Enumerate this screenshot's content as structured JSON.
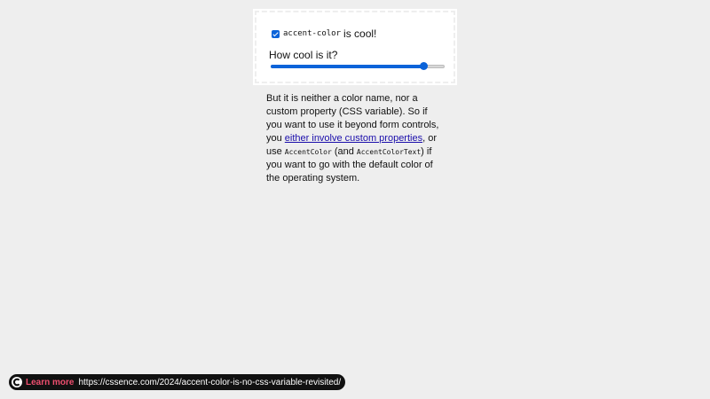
{
  "card": {
    "checkbox_checked": true,
    "checkbox_code": "accent-color",
    "checkbox_label": "is cool!",
    "slider_label": "How cool is it?",
    "slider_value_fraction": 0.88
  },
  "prose": {
    "text_1": "But it is neither a color name, nor a custom property (CSS variable). So if you want to use it beyond form controls, you ",
    "link_text": "either involve custom properties",
    "text_2": ", or use ",
    "code_1": "AccentColor",
    "text_3": " (and ",
    "code_2": "AccentColorText",
    "text_4": ") if you want to go with the default color of the operating system."
  },
  "badge": {
    "icon": "cssence-logo-icon",
    "label": "Learn more",
    "url": "https://cssence.com/2024/accent-color-is-no-css-variable-revisited/"
  },
  "colors": {
    "accent": "#0b63d9",
    "page_background": "#eeeeee",
    "badge_background": "#111111",
    "badge_label": "#ef4f6f"
  }
}
